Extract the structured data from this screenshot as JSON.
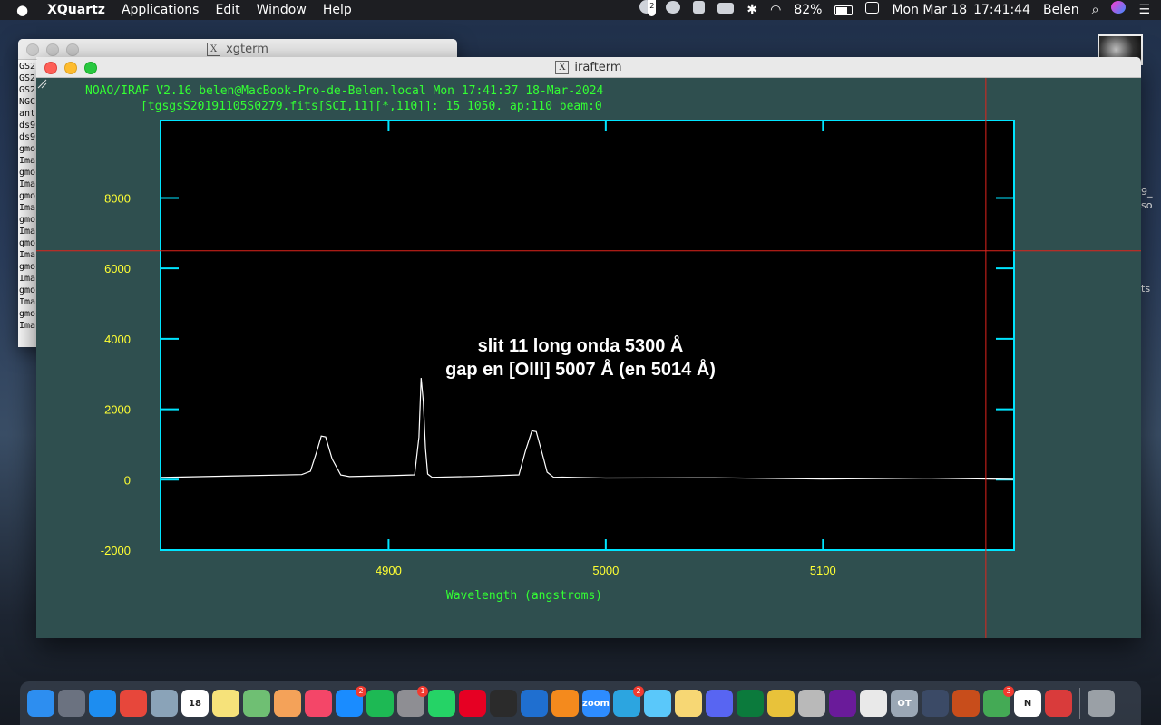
{
  "menubar": {
    "app_name": "XQuartz",
    "menus": [
      "Applications",
      "Edit",
      "Window",
      "Help"
    ],
    "battery": "82%",
    "date": "Mon Mar 18",
    "time": "17:41:44",
    "user": "Belen",
    "badge_count": "2"
  },
  "xgterm": {
    "title": "xgterm",
    "lines": [
      "GS2",
      "GS2",
      "GS2",
      "NGC",
      "ant",
      "ds9",
      "ds9",
      "gmo",
      "Ima",
      "gmo",
      "Ima",
      "gmo",
      "Ima",
      "gmo",
      "Ima",
      "gmo",
      "Ima",
      "gmo",
      "Ima",
      "gmo",
      "Ima",
      "gmo",
      "Ima",
      ""
    ]
  },
  "desktop": {
    "label_1": "9_",
    "label_2": "so",
    "label_3": "ts"
  },
  "irafterm": {
    "title": "irafterm",
    "header_line": "NOAO/IRAF V2.16 belen@MacBook-Pro-de-Belen.local Mon 17:41:37 18-Mar-2024",
    "subheader_line": "[tgsgsS20191105S0279.fits[SCI,11][*,110]]: 15 1050. ap:110 beam:0",
    "annotation_line1": "slit 11 long onda 5300 Å",
    "annotation_line2": "gap en [OIII] 5007 Å (en 5014 Å)"
  },
  "chart_data": {
    "type": "line",
    "xlabel": "Wavelength (angstroms)",
    "ylabel": "",
    "xlim": [
      4795,
      5188
    ],
    "ylim": [
      -2000,
      10200
    ],
    "x_ticks": [
      4900,
      5000,
      5100
    ],
    "y_ticks": [
      -2000,
      0,
      2000,
      4000,
      6000,
      8000
    ],
    "series": [
      {
        "x": [
          4795,
          4830,
          4860,
          4864,
          4867,
          4869,
          4871,
          4874,
          4878,
          4882,
          4900,
          4912,
          4914,
          4915,
          4916,
          4917,
          4918,
          4920,
          4940,
          4960,
          4963,
          4966,
          4968,
          4971,
          4973,
          4976,
          4980,
          5000,
          5050,
          5100,
          5150,
          5188
        ],
        "y": [
          50,
          120,
          130,
          250,
          800,
          1250,
          1200,
          600,
          120,
          100,
          100,
          150,
          1200,
          2900,
          2200,
          900,
          150,
          80,
          80,
          150,
          800,
          1400,
          1350,
          700,
          200,
          80,
          60,
          60,
          40,
          30,
          30,
          20
        ]
      }
    ],
    "cursor": {
      "x": 5175,
      "y": 6500
    },
    "colors": {
      "axis": "#00e5ff",
      "label": "#ffff33",
      "title": "#33ff33",
      "line": "#ffffff",
      "cursor": "#e0241c"
    }
  },
  "dock": {
    "apps": [
      {
        "name": "finder-icon",
        "color": "#2d8ef0",
        "label": ""
      },
      {
        "name": "launchpad-icon",
        "color": "#6b7280",
        "label": ""
      },
      {
        "name": "safari-icon",
        "color": "#1d8df0",
        "label": ""
      },
      {
        "name": "chrome-icon",
        "color": "#e7473b",
        "label": ""
      },
      {
        "name": "preview-icon",
        "color": "#8aa3b8",
        "label": ""
      },
      {
        "name": "calendar-icon",
        "color": "#ffffff",
        "label": "18"
      },
      {
        "name": "notes-icon",
        "color": "#f6e27a",
        "label": ""
      },
      {
        "name": "maps-icon",
        "color": "#6fbf73",
        "label": ""
      },
      {
        "name": "photos-icon",
        "color": "#f4a259",
        "label": ""
      },
      {
        "name": "music-icon",
        "color": "#f44668",
        "label": ""
      },
      {
        "name": "appstore-icon",
        "color": "#1a8cff",
        "label": "",
        "badge": "2"
      },
      {
        "name": "spotify-icon",
        "color": "#1db954",
        "label": ""
      },
      {
        "name": "system-preferences-icon",
        "color": "#8e8e93",
        "label": "",
        "badge": "1"
      },
      {
        "name": "whatsapp-icon",
        "color": "#25d366",
        "label": ""
      },
      {
        "name": "pinterest-icon",
        "color": "#e60023",
        "label": ""
      },
      {
        "name": "terminal-icon",
        "color": "#2b2b2b",
        "label": ""
      },
      {
        "name": "vscode-icon",
        "color": "#1f6fd0",
        "label": ""
      },
      {
        "name": "sublime-icon",
        "color": "#f48a1d",
        "label": ""
      },
      {
        "name": "zoom-icon",
        "color": "#2d8cff",
        "label": "zoom"
      },
      {
        "name": "telegram-icon",
        "color": "#2ca5e0",
        "label": "",
        "badge": "2"
      },
      {
        "name": "messages-icon",
        "color": "#5ac8fa",
        "label": ""
      },
      {
        "name": "stickies-icon",
        "color": "#f7d774",
        "label": ""
      },
      {
        "name": "discord-icon",
        "color": "#5865f2",
        "label": ""
      },
      {
        "name": "progress-ring-icon",
        "color": "#0b7a3c",
        "label": ""
      },
      {
        "name": "cyberduck-icon",
        "color": "#e8c23a",
        "label": ""
      },
      {
        "name": "file-icon",
        "color": "#b9b9b9",
        "label": ""
      },
      {
        "name": "galaxy-icon",
        "color": "#6a1b9a",
        "label": ""
      },
      {
        "name": "textedit-icon",
        "color": "#e9e9e9",
        "label": ""
      },
      {
        "name": "ot-icon",
        "color": "#9aa7b5",
        "label": "OT"
      },
      {
        "name": "telescope-icon",
        "color": "#3b4a66",
        "label": ""
      },
      {
        "name": "astro-icon",
        "color": "#c84d1b",
        "label": ""
      },
      {
        "name": "gift-icon",
        "color": "#44aa55",
        "label": "",
        "badge": "3"
      },
      {
        "name": "notion-icon",
        "color": "#ffffff",
        "label": "N"
      },
      {
        "name": "puzzle-icon",
        "color": "#d93b3b",
        "label": ""
      },
      {
        "name": "trash-icon",
        "color": "#9aa0a6",
        "label": ""
      }
    ]
  }
}
